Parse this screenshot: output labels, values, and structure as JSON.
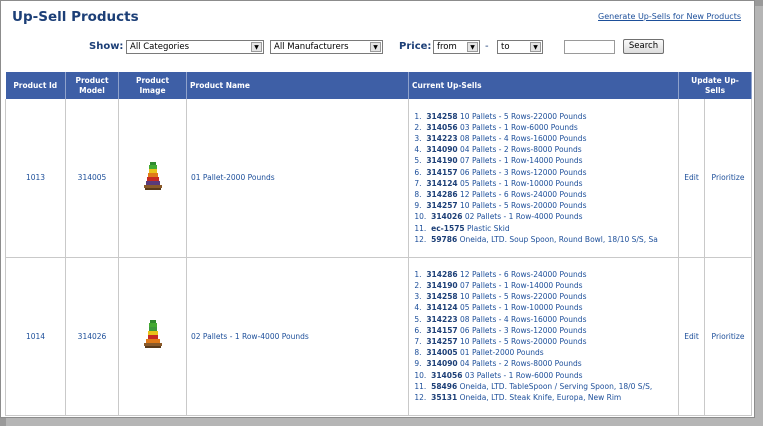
{
  "page": {
    "title": "Up-Sell Products",
    "generate_link": "Generate Up-Sells for New Products"
  },
  "filters": {
    "show_label": "Show:",
    "category": "All Categories",
    "manufacturer": "All Manufacturers",
    "price_label": "Price:",
    "price_from": "from",
    "price_dash": "-",
    "price_to": "to",
    "search_value": "",
    "search_button": "Search"
  },
  "table": {
    "headers": {
      "product_id": "Product Id",
      "product_model": "Product Model",
      "product_image": "Product Image",
      "product_name": "Product Name",
      "current_upsells": "Current Up-Sells",
      "update_upsells": "Update Up-Sells"
    },
    "rows": [
      {
        "product_id": "1013",
        "product_model": "314005",
        "product_name": "01 Pallet-2000 Pounds",
        "edit": "Edit",
        "prioritize": "Prioritize",
        "upsells": [
          {
            "num": "1.",
            "code": "314258",
            "name": "10 Pallets - 5 Rows-22000 Pounds"
          },
          {
            "num": "2.",
            "code": "314056",
            "name": "03 Pallets - 1 Row-6000 Pounds"
          },
          {
            "num": "3.",
            "code": "314223",
            "name": "08 Pallets - 4 Rows-16000 Pounds"
          },
          {
            "num": "4.",
            "code": "314090",
            "name": "04 Pallets - 2 Rows-8000 Pounds"
          },
          {
            "num": "5.",
            "code": "314190",
            "name": "07 Pallets - 1 Row-14000 Pounds"
          },
          {
            "num": "6.",
            "code": "314157",
            "name": "06 Pallets - 3 Rows-12000 Pounds"
          },
          {
            "num": "7.",
            "code": "314124",
            "name": "05 Pallets - 1 Row-10000 Pounds"
          },
          {
            "num": "8.",
            "code": "314286",
            "name": "12 Pallets - 6 Rows-24000 Pounds"
          },
          {
            "num": "9.",
            "code": "314257",
            "name": "10 Pallets - 5 Rows-20000 Pounds"
          },
          {
            "num": "10.",
            "code": "314026",
            "name": "02 Pallets - 1 Row-4000 Pounds"
          },
          {
            "num": "11.",
            "code": "ec-1575",
            "name": "Plastic Skid"
          },
          {
            "num": "12.",
            "code": "59786",
            "name": "Oneida, LTD. Soup Spoon, Round Bowl, 18/10 S/S, Sa"
          }
        ]
      },
      {
        "product_id": "1014",
        "product_model": "314026",
        "product_name": "02 Pallets - 1 Row-4000 Pounds",
        "edit": "Edit",
        "prioritize": "Prioritize",
        "upsells": [
          {
            "num": "1.",
            "code": "314286",
            "name": "12 Pallets - 6 Rows-24000 Pounds"
          },
          {
            "num": "2.",
            "code": "314190",
            "name": "07 Pallets - 1 Row-14000 Pounds"
          },
          {
            "num": "3.",
            "code": "314258",
            "name": "10 Pallets - 5 Rows-22000 Pounds"
          },
          {
            "num": "4.",
            "code": "314124",
            "name": "05 Pallets - 1 Row-10000 Pounds"
          },
          {
            "num": "5.",
            "code": "314223",
            "name": "08 Pallets - 4 Rows-16000 Pounds"
          },
          {
            "num": "6.",
            "code": "314157",
            "name": "06 Pallets - 3 Rows-12000 Pounds"
          },
          {
            "num": "7.",
            "code": "314257",
            "name": "10 Pallets - 5 Rows-20000 Pounds"
          },
          {
            "num": "8.",
            "code": "314005",
            "name": "01 Pallet-2000 Pounds"
          },
          {
            "num": "9.",
            "code": "314090",
            "name": "04 Pallets - 2 Rows-8000 Pounds"
          },
          {
            "num": "10.",
            "code": "314056",
            "name": "03 Pallets - 1 Row-6000 Pounds"
          },
          {
            "num": "11.",
            "code": "58496",
            "name": "Oneida, LTD. TableSpoon / Serving Spoon, 18/0 S/S,"
          },
          {
            "num": "12.",
            "code": "35131",
            "name": "Oneida, LTD. Steak Knife, Europa, New Rim"
          }
        ]
      }
    ]
  },
  "colors": {
    "header_bg": "#3e5fa6",
    "title": "#1c3f77",
    "link": "#1d4f9a"
  }
}
